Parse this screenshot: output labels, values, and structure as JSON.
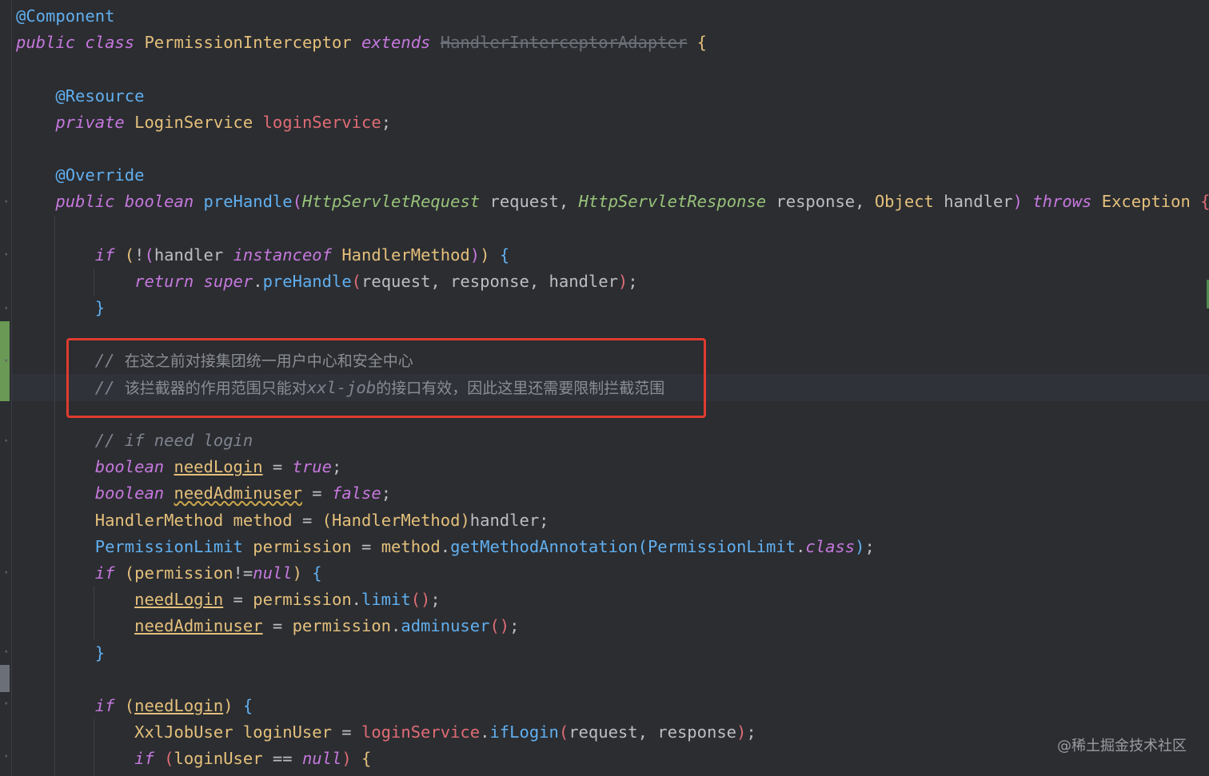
{
  "code_lines": [
    {
      "parts": [
        [
          "ann",
          "@Component"
        ]
      ]
    },
    {
      "parts": [
        [
          "kw",
          "public"
        ],
        [
          "pl",
          " "
        ],
        [
          "kw",
          "class"
        ],
        [
          "pl",
          " "
        ],
        [
          "cls",
          "PermissionInterceptor"
        ],
        [
          "pl",
          " "
        ],
        [
          "kw",
          "extends"
        ],
        [
          "pl",
          " "
        ],
        [
          "dep",
          "HandlerInterceptorAdapter"
        ],
        [
          "pl",
          " "
        ],
        [
          "bk1",
          "{"
        ]
      ]
    },
    {
      "parts": []
    },
    {
      "parts": [
        [
          "pl",
          "    "
        ],
        [
          "ann",
          "@Resource"
        ]
      ]
    },
    {
      "parts": [
        [
          "pl",
          "    "
        ],
        [
          "kw",
          "private"
        ],
        [
          "pl",
          " "
        ],
        [
          "cls",
          "LoginService"
        ],
        [
          "pl",
          " "
        ],
        [
          "fld",
          "loginService"
        ],
        [
          "pl",
          ";"
        ]
      ]
    },
    {
      "parts": []
    },
    {
      "parts": [
        [
          "pl",
          "    "
        ],
        [
          "ann",
          "@Override"
        ]
      ]
    },
    {
      "parts": [
        [
          "pl",
          "    "
        ],
        [
          "kw",
          "public"
        ],
        [
          "pl",
          " "
        ],
        [
          "kw",
          "boolean"
        ],
        [
          "pl",
          " "
        ],
        [
          "mth",
          "preHandle"
        ],
        [
          "bk2",
          "("
        ],
        [
          "iface",
          "HttpServletRequest"
        ],
        [
          "pl",
          " request, "
        ],
        [
          "iface",
          "HttpServletResponse"
        ],
        [
          "pl",
          " response, "
        ],
        [
          "cls",
          "Object"
        ],
        [
          "pl",
          " handler"
        ],
        [
          "bk2",
          ")"
        ],
        [
          "pl",
          " "
        ],
        [
          "kw",
          "throws"
        ],
        [
          "pl",
          " "
        ],
        [
          "cls",
          "Exception"
        ],
        [
          "pl",
          " "
        ],
        [
          "bk4",
          "{"
        ]
      ]
    },
    {
      "parts": []
    },
    {
      "parts": [
        [
          "pl",
          "        "
        ],
        [
          "kw",
          "if"
        ],
        [
          "pl",
          " "
        ],
        [
          "bk1",
          "("
        ],
        [
          "pl",
          "!"
        ],
        [
          "bk2",
          "("
        ],
        [
          "pl",
          "handler "
        ],
        [
          "kw",
          "instanceof"
        ],
        [
          "pl",
          " "
        ],
        [
          "cls",
          "HandlerMethod"
        ],
        [
          "bk2",
          ")"
        ],
        [
          "bk1",
          ")"
        ],
        [
          "pl",
          " "
        ],
        [
          "bk3",
          "{"
        ]
      ]
    },
    {
      "parts": [
        [
          "pl",
          "            "
        ],
        [
          "kw",
          "return"
        ],
        [
          "pl",
          " "
        ],
        [
          "kw",
          "super"
        ],
        [
          "pl",
          "."
        ],
        [
          "mth",
          "preHandle"
        ],
        [
          "bk4",
          "("
        ],
        [
          "pl",
          "request, response, handler"
        ],
        [
          "bk4",
          ")"
        ],
        [
          "pl",
          ";"
        ]
      ]
    },
    {
      "parts": [
        [
          "pl",
          "        "
        ],
        [
          "bk3",
          "}"
        ]
      ]
    },
    {
      "parts": []
    },
    {
      "parts": [
        [
          "pl",
          "        "
        ],
        [
          "cmt",
          "// "
        ],
        [
          "cmt-cn",
          "在这之前对接集团统一用户中心和安全中心"
        ]
      ]
    },
    {
      "parts": [
        [
          "pl",
          "        "
        ],
        [
          "cmt",
          "// "
        ],
        [
          "cmt-cn",
          "该拦截器的作用范围只能对"
        ],
        [
          "cmt",
          "xxl-job"
        ],
        [
          "cmt-cn",
          "的接口有效，因此这里还需要限制拦截范围"
        ]
      ]
    },
    {
      "parts": []
    },
    {
      "parts": [
        [
          "pl",
          "        "
        ],
        [
          "cmt",
          "// if need login"
        ]
      ]
    },
    {
      "parts": [
        [
          "pl",
          "        "
        ],
        [
          "kw",
          "boolean"
        ],
        [
          "pl",
          " "
        ],
        [
          "lvar",
          "needLogin"
        ],
        [
          "pl",
          " = "
        ],
        [
          "kw",
          "true"
        ],
        [
          "pl",
          ";"
        ]
      ]
    },
    {
      "parts": [
        [
          "pl",
          "        "
        ],
        [
          "kw",
          "boolean"
        ],
        [
          "pl",
          " "
        ],
        [
          "lvar warn",
          "needAdminuser"
        ],
        [
          "pl",
          " = "
        ],
        [
          "kw",
          "false"
        ],
        [
          "pl",
          ";"
        ]
      ]
    },
    {
      "parts": [
        [
          "pl",
          "        "
        ],
        [
          "cls",
          "HandlerMethod"
        ],
        [
          "pl",
          " "
        ],
        [
          "cls",
          "method"
        ],
        [
          "pl",
          " = "
        ],
        [
          "bk1",
          "("
        ],
        [
          "cls",
          "HandlerMethod"
        ],
        [
          "bk1",
          ")"
        ],
        [
          "pl",
          "handler;"
        ]
      ]
    },
    {
      "parts": [
        [
          "pl",
          "        "
        ],
        [
          "cst",
          "PermissionLimit"
        ],
        [
          "pl",
          " "
        ],
        [
          "cls",
          "permission"
        ],
        [
          "pl",
          " = "
        ],
        [
          "cls",
          "method"
        ],
        [
          "pl",
          "."
        ],
        [
          "mth",
          "getMethodAnnotation"
        ],
        [
          "bk3",
          "("
        ],
        [
          "cst",
          "PermissionLimit"
        ],
        [
          "pl",
          "."
        ],
        [
          "kw",
          "class"
        ],
        [
          "bk3",
          ")"
        ],
        [
          "pl",
          ";"
        ]
      ]
    },
    {
      "parts": [
        [
          "pl",
          "        "
        ],
        [
          "kw",
          "if"
        ],
        [
          "pl",
          " "
        ],
        [
          "bk1",
          "("
        ],
        [
          "cls",
          "permission"
        ],
        [
          "pl",
          "!="
        ],
        [
          "kw",
          "null"
        ],
        [
          "bk1",
          ")"
        ],
        [
          "pl",
          " "
        ],
        [
          "bk3",
          "{"
        ]
      ]
    },
    {
      "parts": [
        [
          "pl",
          "            "
        ],
        [
          "lvar",
          "needLogin"
        ],
        [
          "pl",
          " = "
        ],
        [
          "cls",
          "permission"
        ],
        [
          "pl",
          "."
        ],
        [
          "mth",
          "limit"
        ],
        [
          "bk4",
          "()"
        ],
        [
          "pl",
          ";"
        ]
      ]
    },
    {
      "parts": [
        [
          "pl",
          "            "
        ],
        [
          "lvar",
          "needAdminuser"
        ],
        [
          "pl",
          " = "
        ],
        [
          "cls",
          "permission"
        ],
        [
          "pl",
          "."
        ],
        [
          "mth",
          "adminuser"
        ],
        [
          "bk4",
          "()"
        ],
        [
          "pl",
          ";"
        ]
      ]
    },
    {
      "parts": [
        [
          "pl",
          "        "
        ],
        [
          "bk3",
          "}"
        ]
      ]
    },
    {
      "parts": []
    },
    {
      "parts": [
        [
          "pl",
          "        "
        ],
        [
          "kw",
          "if"
        ],
        [
          "pl",
          " "
        ],
        [
          "bk1",
          "("
        ],
        [
          "lvar",
          "needLogin"
        ],
        [
          "bk1",
          ")"
        ],
        [
          "pl",
          " "
        ],
        [
          "bk3",
          "{"
        ]
      ]
    },
    {
      "parts": [
        [
          "pl",
          "            "
        ],
        [
          "cls",
          "XxlJobUser"
        ],
        [
          "pl",
          " "
        ],
        [
          "cls",
          "loginUser"
        ],
        [
          "pl",
          " = "
        ],
        [
          "fld",
          "loginService"
        ],
        [
          "pl",
          "."
        ],
        [
          "mth",
          "ifLogin"
        ],
        [
          "bk4",
          "("
        ],
        [
          "pl",
          "request, response"
        ],
        [
          "bk4",
          ")"
        ],
        [
          "pl",
          ";"
        ]
      ]
    },
    {
      "parts": [
        [
          "pl",
          "            "
        ],
        [
          "kw",
          "if"
        ],
        [
          "pl",
          " "
        ],
        [
          "bk4",
          "("
        ],
        [
          "cls",
          "loginUser"
        ],
        [
          "pl",
          " == "
        ],
        [
          "kw",
          "null"
        ],
        [
          "bk4",
          ")"
        ],
        [
          "pl",
          " "
        ],
        [
          "bk1",
          "{"
        ]
      ]
    }
  ],
  "watermark": "@稀土掘金技术社区",
  "colors": {
    "background": "#2b2d31",
    "highlight_box": "#e03b2e",
    "added_change": "#6a9955"
  }
}
